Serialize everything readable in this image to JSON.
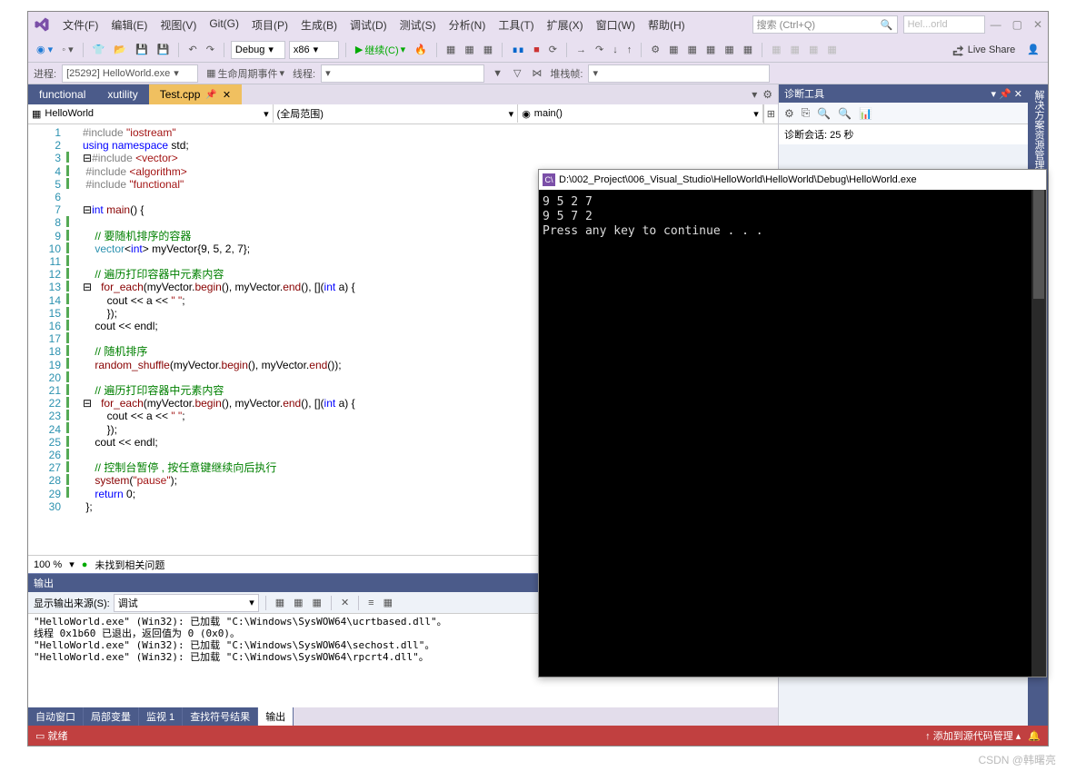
{
  "menu": [
    "文件(F)",
    "编辑(E)",
    "视图(V)",
    "Git(G)",
    "项目(P)",
    "生成(B)",
    "调试(D)",
    "测试(S)",
    "分析(N)",
    "工具(T)",
    "扩展(X)",
    "窗口(W)",
    "帮助(H)"
  ],
  "search_placeholder": "搜索 (Ctrl+Q)",
  "solution_hint": "Hel...orld",
  "toolbar": {
    "config": "Debug",
    "platform": "x86",
    "continue": "继续(C)",
    "liveshare": "Live Share"
  },
  "toolbar2": {
    "process_label": "进程:",
    "process_value": "[25292] HelloWorld.exe",
    "lifecycle": "生命周期事件",
    "thread_label": "线程:",
    "stackframe_label": "堆栈帧:"
  },
  "tabs": [
    {
      "label": "functional",
      "active": false
    },
    {
      "label": "xutility",
      "active": false
    },
    {
      "label": "Test.cpp",
      "active": true
    }
  ],
  "nav": {
    "scope1": "HelloWorld",
    "scope2": "(全局范围)",
    "scope3": "main()"
  },
  "code_lines": [
    {
      "n": 1,
      "bar": "",
      "html": "<span class='c-pp'>#include</span> <span class='c-str'>\"iostream\"</span>"
    },
    {
      "n": 2,
      "bar": "",
      "html": "<span class='c-kw'>using</span> <span class='c-kw'>namespace</span> std;"
    },
    {
      "n": 3,
      "bar": "g",
      "html": "⊟<span class='c-pp'>#include</span> <span class='c-str'>&lt;vector&gt;</span>"
    },
    {
      "n": 4,
      "bar": "g",
      "html": " <span class='c-pp'>#include</span> <span class='c-str'>&lt;algorithm&gt;</span>"
    },
    {
      "n": 5,
      "bar": "g",
      "html": " <span class='c-pp'>#include</span> <span class='c-str'>\"functional\"</span>"
    },
    {
      "n": 6,
      "bar": "",
      "html": ""
    },
    {
      "n": 7,
      "bar": "",
      "html": "⊟<span class='c-kw'>int</span> <span class='c-fn'>main</span>() {"
    },
    {
      "n": 8,
      "bar": "g",
      "html": ""
    },
    {
      "n": 9,
      "bar": "g",
      "html": "    <span class='c-cm'>// 要随机排序的容器</span>"
    },
    {
      "n": 10,
      "bar": "g",
      "html": "    <span class='c-ty'>vector</span>&lt;<span class='c-kw'>int</span>&gt; myVector{9, 5, 2, 7};"
    },
    {
      "n": 11,
      "bar": "g",
      "html": ""
    },
    {
      "n": 12,
      "bar": "g",
      "html": "    <span class='c-cm'>// 遍历打印容器中元素内容</span>"
    },
    {
      "n": 13,
      "bar": "g",
      "html": "⊟   <span class='c-fn'>for_each</span>(myVector.<span class='c-fn'>begin</span>(), myVector.<span class='c-fn'>end</span>(), [](<span class='c-kw'>int</span> a) {"
    },
    {
      "n": 14,
      "bar": "g",
      "html": "        cout &lt;&lt; a &lt;&lt; <span class='c-str'>\" \"</span>;"
    },
    {
      "n": 15,
      "bar": "g",
      "html": "        });"
    },
    {
      "n": 16,
      "bar": "g",
      "html": "    cout &lt;&lt; endl;"
    },
    {
      "n": 17,
      "bar": "g",
      "html": ""
    },
    {
      "n": 18,
      "bar": "g",
      "html": "    <span class='c-cm'>// 随机排序</span>"
    },
    {
      "n": 19,
      "bar": "g",
      "html": "    <span class='c-fn'>random_shuffle</span>(myVector.<span class='c-fn'>begin</span>(), myVector.<span class='c-fn'>end</span>());"
    },
    {
      "n": 20,
      "bar": "g",
      "html": ""
    },
    {
      "n": 21,
      "bar": "g",
      "html": "    <span class='c-cm'>// 遍历打印容器中元素内容</span>"
    },
    {
      "n": 22,
      "bar": "g",
      "html": "⊟   <span class='c-fn'>for_each</span>(myVector.<span class='c-fn'>begin</span>(), myVector.<span class='c-fn'>end</span>(), [](<span class='c-kw'>int</span> a) {"
    },
    {
      "n": 23,
      "bar": "g",
      "html": "        cout &lt;&lt; a &lt;&lt; <span class='c-str'>\" \"</span>;"
    },
    {
      "n": 24,
      "bar": "g",
      "html": "        });"
    },
    {
      "n": 25,
      "bar": "g",
      "html": "    cout &lt;&lt; endl;"
    },
    {
      "n": 26,
      "bar": "g",
      "html": ""
    },
    {
      "n": 27,
      "bar": "g",
      "html": "    <span class='c-cm'>// 控制台暂停 , 按任意键继续向后执行</span>"
    },
    {
      "n": 28,
      "bar": "g",
      "html": "    <span class='c-fn'>system</span>(<span class='c-str'>\"pause\"</span>);"
    },
    {
      "n": 29,
      "bar": "g",
      "html": "    <span class='c-kw'>return</span> 0;"
    },
    {
      "n": 30,
      "bar": "",
      "html": " };"
    }
  ],
  "editor_status": {
    "zoom": "100 %",
    "issues": "未找到相关问题"
  },
  "output": {
    "title": "输出",
    "src_label": "显示输出来源(S):",
    "src_value": "调试",
    "lines": [
      "\"HelloWorld.exe\" (Win32): 已加载 \"C:\\Windows\\SysWOW64\\ucrtbased.dll\"。",
      "线程 0x1b60 已退出，返回值为 0 (0x0)。",
      "\"HelloWorld.exe\" (Win32): 已加载 \"C:\\Windows\\SysWOW64\\sechost.dll\"。",
      "\"HelloWorld.exe\" (Win32): 已加载 \"C:\\Windows\\SysWOW64\\rpcrt4.dll\"。"
    ]
  },
  "bottom_tabs": [
    "自动窗口",
    "局部变量",
    "监视 1",
    "查找符号结果",
    "输出"
  ],
  "bottom_active": 4,
  "diag": {
    "title": "诊断工具",
    "session": "诊断会话: 25 秒"
  },
  "sidebar_label": "解决方案资源管理器",
  "statusbar": {
    "ready": "就绪",
    "scm": "添加到源代码管理"
  },
  "console": {
    "title": "D:\\002_Project\\006_Visual_Studio\\HelloWorld\\HelloWorld\\Debug\\HelloWorld.exe",
    "lines": [
      "9 5 2 7",
      "9 5 7 2",
      "Press any key to continue . . ."
    ]
  },
  "watermark": "CSDN @韩曙亮"
}
